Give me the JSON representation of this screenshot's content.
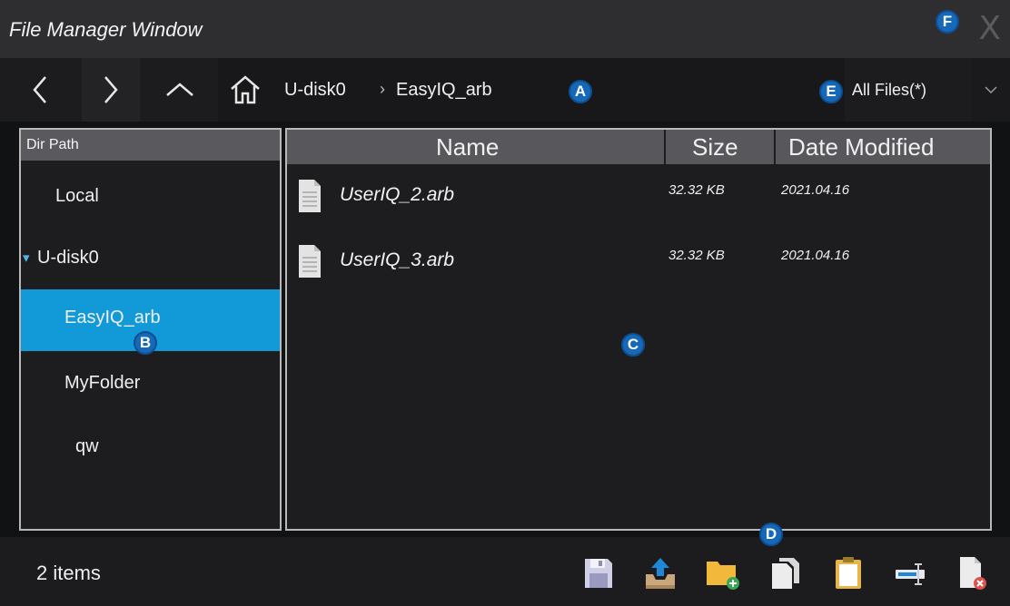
{
  "window": {
    "title": "File Manager Window",
    "close_label": "X"
  },
  "nav": {
    "back_icon": "chevron-left-icon",
    "forward_icon": "chevron-right-icon",
    "up_icon": "chevron-up-icon"
  },
  "path": {
    "home_icon": "home-icon",
    "segments": [
      "U-disk0",
      "EasyIQ_arb"
    ],
    "separator": "›"
  },
  "filter": {
    "selected": "All Files(*)"
  },
  "dir_pane": {
    "header": "Dir Path",
    "items": [
      {
        "label": "Local"
      },
      {
        "label": "U-disk0",
        "expander": "▾"
      },
      {
        "label": "EasyIQ_arb"
      },
      {
        "label": "MyFolder"
      },
      {
        "label": "qw"
      }
    ]
  },
  "file_pane": {
    "columns": [
      "Name",
      "Size",
      "Date Modified"
    ],
    "rows": [
      {
        "name": "UserIQ_2.arb",
        "size": "32.32 KB",
        "date": "2021.04.16"
      },
      {
        "name": "UserIQ_3.arb",
        "size": "32.32 KB",
        "date": "2021.04.16"
      }
    ]
  },
  "status": {
    "count": "2 items"
  },
  "markers": [
    "A",
    "B",
    "C",
    "D",
    "E",
    "F"
  ],
  "colors": {
    "accent": "#129ad8",
    "marker": "#1668b8",
    "background": "#111214"
  }
}
